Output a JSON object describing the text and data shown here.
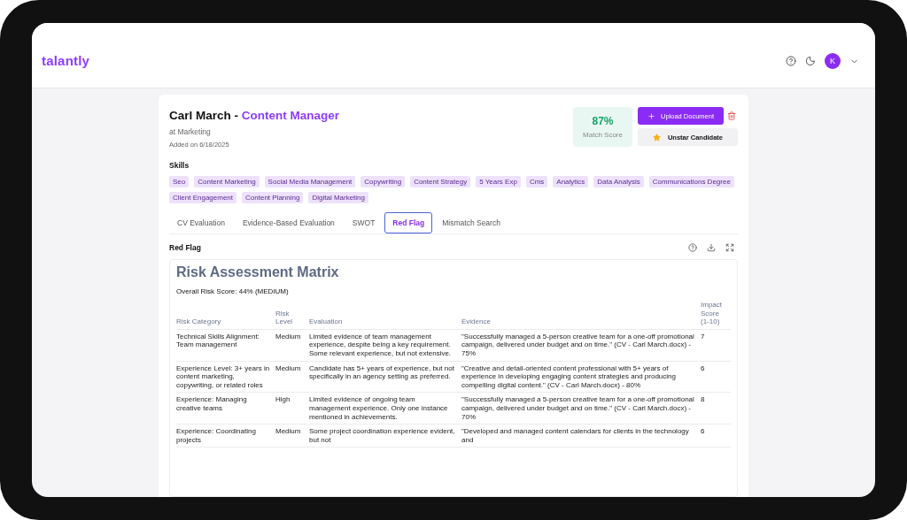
{
  "header": {
    "logo": "talantly",
    "avatar": "K"
  },
  "candidate": {
    "name": "Carl March",
    "separator": "-",
    "role": "Content Manager",
    "department": "at Marketing",
    "added": "Added on 6/18/2025"
  },
  "match": {
    "score": "87%",
    "label": "Match Score"
  },
  "actions": {
    "upload": "Upload Document",
    "unstar": "Unstar Candidate"
  },
  "skills": {
    "title": "Skills",
    "items": [
      "Seo",
      "Content Marketing",
      "Social Media Management",
      "Copywriting",
      "Content Strategy",
      "5 Years Exp",
      "Cms",
      "Analytics",
      "Data Analysis",
      "Communications Degree",
      "Client Engagement",
      "Content Planning",
      "Digital Marketing"
    ]
  },
  "tabs": [
    {
      "label": "CV Evaluation",
      "selected": false
    },
    {
      "label": "Evidence-Based Evaluation",
      "selected": false
    },
    {
      "label": "SWOT",
      "selected": false
    },
    {
      "label": "Red Flag",
      "selected": true
    },
    {
      "label": "Mismatch Search",
      "selected": false
    }
  ],
  "section": {
    "title": "Red Flag"
  },
  "report": {
    "title": "Risk Assessment Matrix",
    "overall": "Overall Risk Score: 44% (MEDIUM)",
    "columns": [
      "Risk Category",
      "Risk Level",
      "Evaluation",
      "Evidence",
      "Impact Score (1-10)"
    ],
    "rows": [
      [
        "Technical Skills Alignment: Team management",
        "Medium",
        "Limited evidence of team management experience, despite being a key requirement. Some relevant experience, but not extensive.",
        "\"Successfully managed a 5-person creative team for a one-off promotional campaign, delivered under budget and on time.\" (CV - Carl March.docx) - 75%",
        "7"
      ],
      [
        "Experience Level: 3+ years in content marketing, copywriting, or related roles",
        "Medium",
        "Candidate has 5+ years of experience, but not specifically in an agency setting as preferred.",
        "\"Creative and detail-oriented content professional with 5+ years of experience in developing engaging content strategies and producing compelling digital content.\" (CV - Carl March.docx) - 80%",
        "6"
      ],
      [
        "Experience: Managing creative teams",
        "High",
        "Limited evidence of ongoing team management experience. Only one instance mentioned in achievements.",
        "\"Successfully managed a 5-person creative team for a one-off promotional campaign, delivered under budget and on time.\" (CV - Carl March.docx) - 70%",
        "8"
      ],
      [
        "Experience: Coordinating projects",
        "Medium",
        "Some project coordination experience evident, but not",
        "\"Developed and managed content calendars for clients in the technology and",
        "6"
      ]
    ]
  }
}
